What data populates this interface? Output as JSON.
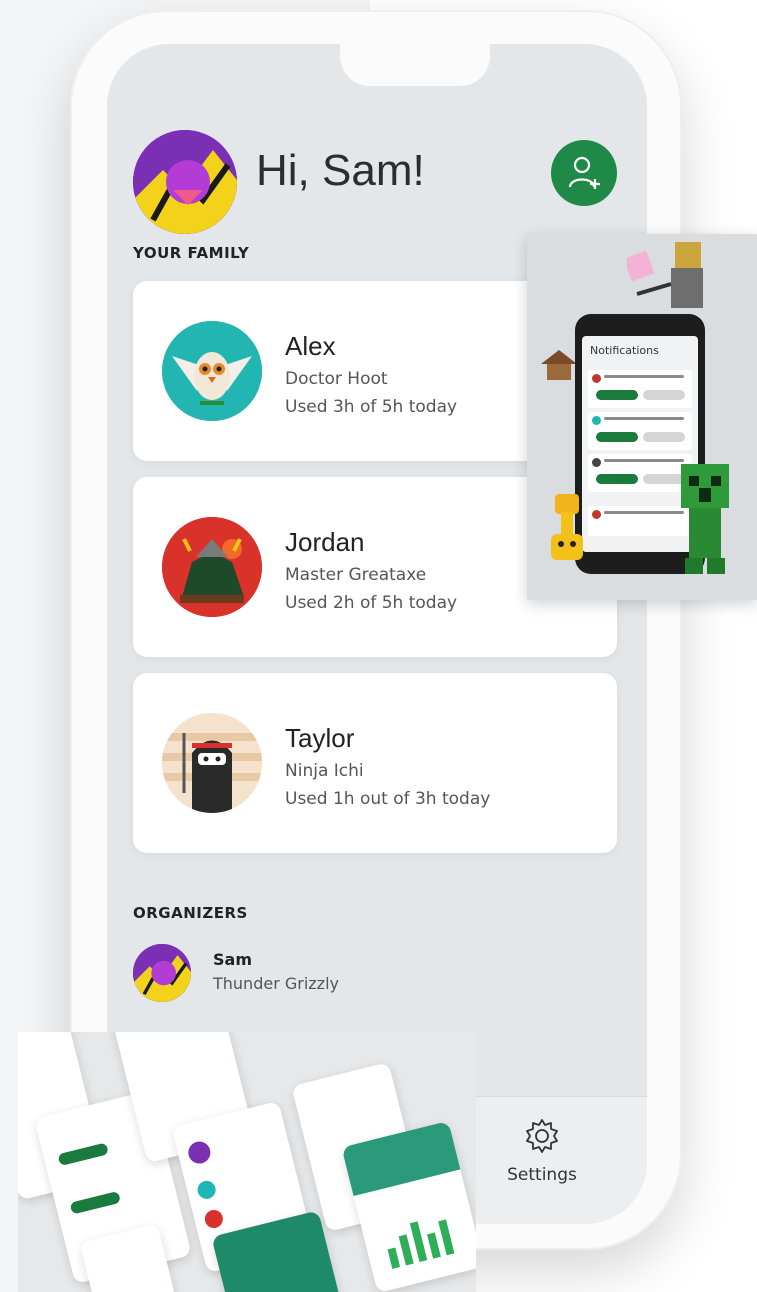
{
  "header": {
    "greeting": "Hi, Sam!",
    "add_member_icon": "add-person-icon"
  },
  "family": {
    "title": "YOUR FAMILY",
    "members": [
      {
        "name": "Alex",
        "gamertag": "Doctor Hoot",
        "usage": "Used 3h of 5h today",
        "avatar_icon": "owl-avatar"
      },
      {
        "name": "Jordan",
        "gamertag": "Master Greataxe",
        "usage": "Used 2h of 5h today",
        "avatar_icon": "monster-avatar"
      },
      {
        "name": "Taylor",
        "gamertag": "Ninja Ichi",
        "usage": "Used 1h out of 3h today",
        "avatar_icon": "ninja-avatar"
      }
    ]
  },
  "organizers": {
    "title": "ORGANIZERS",
    "items": [
      {
        "name": "Sam",
        "gamertag": "Thunder Grizzly",
        "avatar_icon": "grizzly-avatar"
      }
    ]
  },
  "tabbar": {
    "settings_label": "Settings",
    "settings_icon": "gear-icon"
  },
  "promo_notifications": {
    "title": "Notifications"
  },
  "colors": {
    "accent_green": "#1f8a47",
    "screen_bg": "#e4e7ea",
    "card_bg": "#ffffff",
    "text_primary": "#222222",
    "text_secondary": "#555555"
  }
}
